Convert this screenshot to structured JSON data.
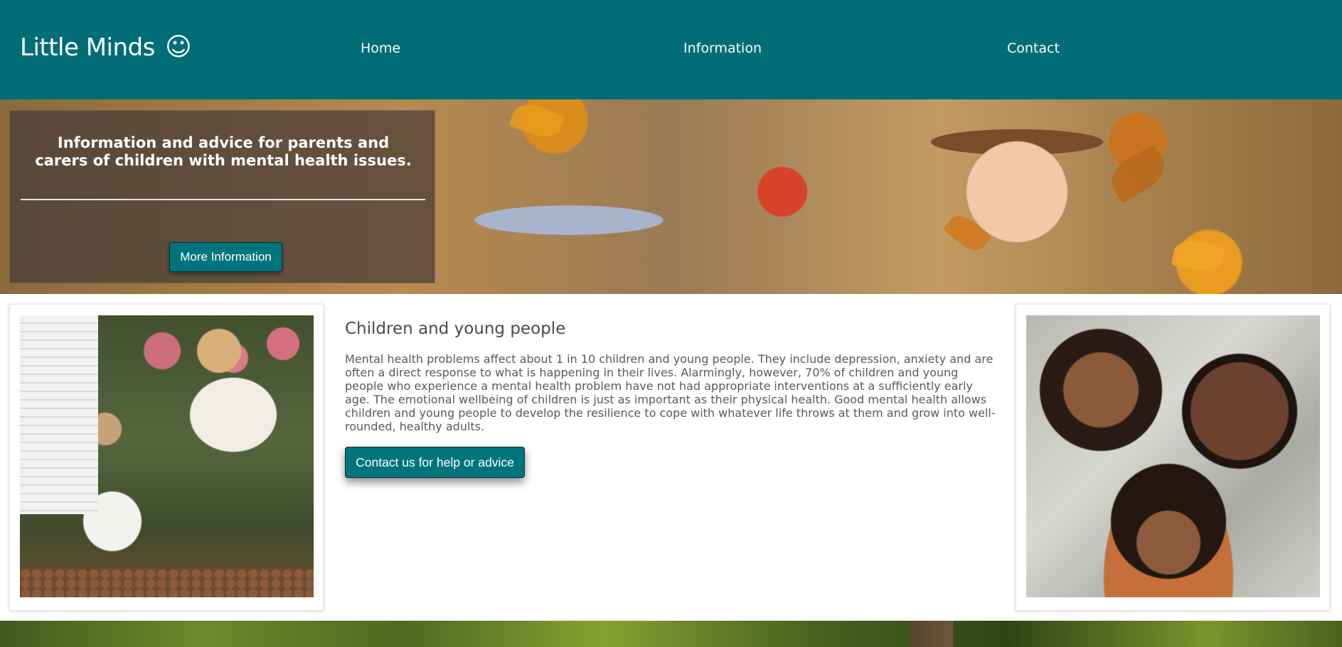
{
  "brand": {
    "name": "Little Minds",
    "icon": "☺"
  },
  "nav": {
    "items": [
      {
        "label": "Home"
      },
      {
        "label": "Information"
      },
      {
        "label": "Contact"
      }
    ]
  },
  "hero": {
    "title": "Information and advice for parents and carers of children with mental health issues.",
    "button_label": "More Information"
  },
  "main": {
    "title": "Children and young people",
    "body": "Mental health problems affect about 1 in 10 children and young people. They include depression, anxiety and are often a direct response to what is happening in their lives. Alarmingly, however, 70% of children and young people who experience a mental health problem have not had appropriate interventions at a sufficiently early age. The emotional wellbeing of children is just as important as their physical health. Good mental health allows children and young people to develop the resilience to cope with whatever life throws at them and grow into well-rounded, healthy adults.",
    "button_label": "Contact us for help or advice"
  },
  "colors": {
    "primary": "#006d77",
    "button": "#00747d",
    "text": "#4a4a4a"
  }
}
